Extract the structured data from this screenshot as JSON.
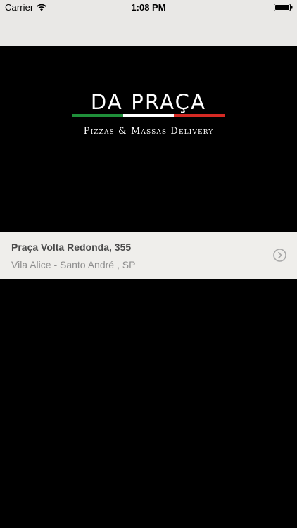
{
  "status_bar": {
    "carrier": "Carrier",
    "time": "1:08 PM",
    "wifi_icon": "wifi-icon",
    "battery_icon": "battery-icon"
  },
  "logo": {
    "title": "DA PRAÇA",
    "subtitle": "Pizzas & Massas Delivery",
    "flag_colors": [
      "#1f8f3a",
      "#ffffff",
      "#d62a24"
    ]
  },
  "address": {
    "street": "Praça Volta Redonda, 355",
    "district": "Vila Alice - Santo André , SP",
    "chevron_icon": "chevron-right-circle-icon"
  },
  "colors": {
    "background": "#000000",
    "top_bar": "#e9e8e6",
    "row_background": "#efeeeb"
  }
}
